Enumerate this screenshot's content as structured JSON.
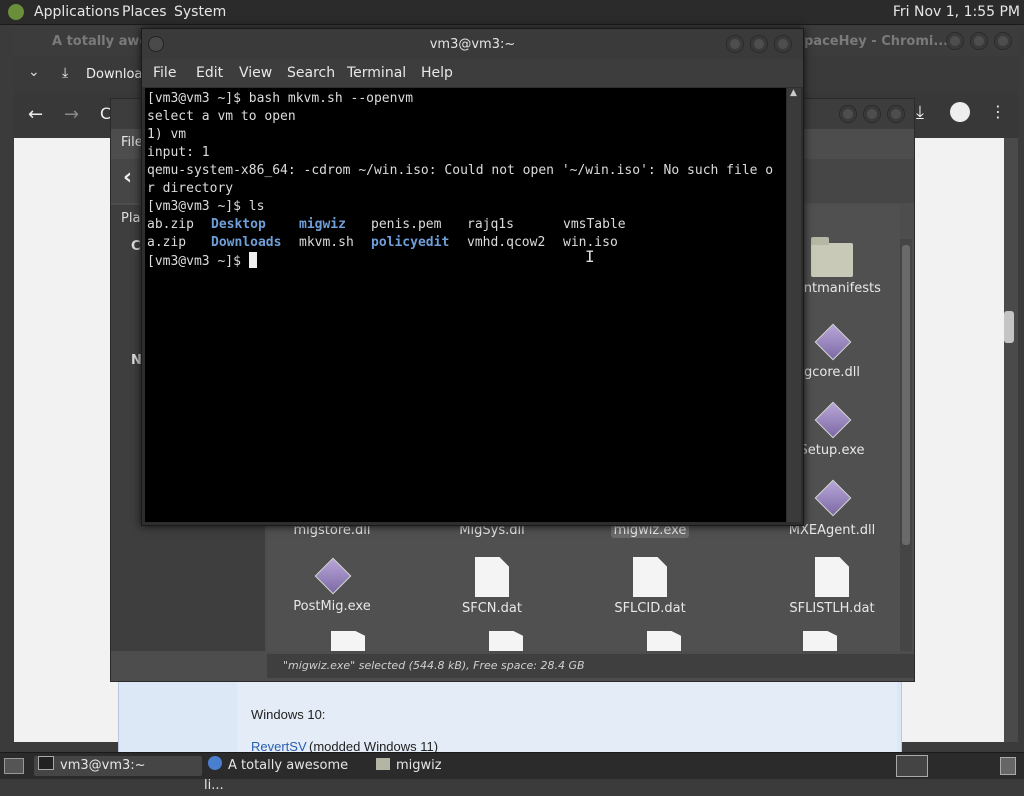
{
  "top_panel": {
    "menus": [
      "Applications",
      "Places",
      "System"
    ],
    "clock": "Fri Nov 1, 1:55 PM"
  },
  "chromium": {
    "title_left": "A totally awesome",
    "title_right": "paceHey - Chromi...",
    "download_label": "Download",
    "web_text_1": "Windows 10:",
    "web_link": "RevertSV",
    "web_text_2": "(modded Windows 11)"
  },
  "file_manager": {
    "menu_file": "File",
    "sidebar_places": "Plac",
    "sidebar_c": "C",
    "sidebar_n": "N",
    "status": "\"migwiz.exe\" selected (544.8 kB), Free space: 28.4 GB",
    "right_col": [
      {
        "name": "mentmanifests",
        "icon": "folder"
      },
      {
        "name": "gcore.dll",
        "icon": "diamond"
      },
      {
        "name": "Setup.exe",
        "icon": "diamond"
      }
    ],
    "row1": [
      {
        "name": "migstore.dll",
        "selected": false
      },
      {
        "name": "MigSys.dll",
        "selected": false
      },
      {
        "name": "migwiz.exe",
        "selected": true
      },
      {
        "name": "MXEAgent.dll",
        "selected": false
      }
    ],
    "row2": [
      {
        "name": "PostMig.exe",
        "icon": "diamond"
      },
      {
        "name": "SFCN.dat",
        "icon": "doc"
      },
      {
        "name": "SFLCID.dat",
        "icon": "doc"
      },
      {
        "name": "SFLISTLH.dat",
        "icon": "doc"
      }
    ]
  },
  "terminal": {
    "title": "vm3@vm3:~",
    "menu": [
      "File",
      "Edit",
      "View",
      "Search",
      "Terminal",
      "Help"
    ],
    "lines": {
      "l1": "[vm3@vm3 ~]$ bash mkvm.sh --openvm",
      "l2": "select a vm to open",
      "l3": "1) vm",
      "l4": "input: 1",
      "l5": "qemu-system-x86_64: -cdrom ~/win.iso: Could not open '~/win.iso': No such file o",
      "l6": "r directory",
      "l7": "[vm3@vm3 ~]$ ls",
      "l10": "[vm3@vm3 ~]$ "
    },
    "ls_row1": [
      "ab.zip",
      "Desktop",
      "migwiz",
      "penis.pem",
      "rajq1s",
      "vmsTable"
    ],
    "ls_row2": [
      "a.zip",
      "Downloads",
      "mkvm.sh",
      "policyedit",
      "vmhd.qcow2",
      "win.iso"
    ]
  },
  "taskbar": {
    "items": [
      "vm3@vm3:~",
      "A totally awesome li...",
      "migwiz"
    ]
  }
}
